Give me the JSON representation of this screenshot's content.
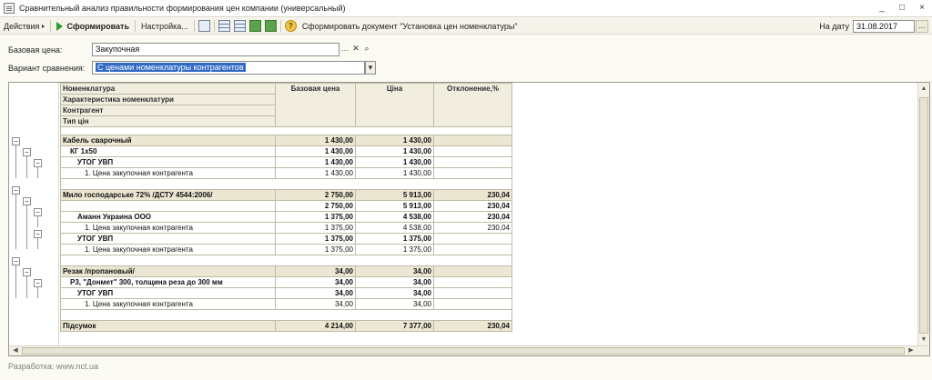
{
  "window": {
    "title": "Сравнительный анализ правильности формирования цен компании (универсальный)",
    "buttons": [
      "_",
      "□",
      "×"
    ]
  },
  "toolbar": {
    "actions": "Действия",
    "generate": "Сформировать",
    "settings": "Настройка...",
    "doc_link": "Сформировать документ \"Установка цен номенклатуры\"",
    "on_date_label": "На дату",
    "on_date_value": "31.08.2017"
  },
  "form": {
    "base_price_label": "Базовая цена:",
    "base_price_value": "Закупочная",
    "compare_label": "Вариант сравнения:",
    "compare_value": "С ценами номенклатуры контрагентов"
  },
  "report": {
    "headers": {
      "col1": [
        "Номенклатура",
        "Характеристика номенклатури",
        "Контрагент",
        "Тип цін"
      ],
      "base": "Базовая цена",
      "price": "Ціна",
      "dev": "Отклонение,%"
    },
    "rows": [
      {
        "type": "grp",
        "name": "Кабель сварочный",
        "base": "1 430,00",
        "price": "1 430,00",
        "dev": ""
      },
      {
        "type": "bold",
        "indent": 1,
        "name": "КГ 1х50",
        "base": "1 430,00",
        "price": "1 430,00",
        "dev": ""
      },
      {
        "type": "bold",
        "indent": 2,
        "name": "УТОГ УВП",
        "base": "1 430,00",
        "price": "1 430,00",
        "dev": ""
      },
      {
        "type": "norm",
        "indent": 3,
        "name": "1. Цена закупочная контрагента",
        "base": "1 430,00",
        "price": "1 430,00",
        "dev": ""
      },
      {
        "type": "spacer"
      },
      {
        "type": "grp",
        "name": "Мило господарське 72% /ДСТУ 4544:2006/",
        "base": "2 750,00",
        "price": "5 913,00",
        "dev": "230,04"
      },
      {
        "type": "bold",
        "indent": 1,
        "name": "",
        "base": "2 750,00",
        "price": "5 913,00",
        "dev": "230,04"
      },
      {
        "type": "bold",
        "indent": 2,
        "name": "Аманн Украина ООО",
        "base": "1 375,00",
        "price": "4 538,00",
        "dev": "230,04"
      },
      {
        "type": "norm",
        "indent": 3,
        "name": "1. Цена закупочная контрагента",
        "base": "1 375,00",
        "price": "4 538,00",
        "dev": "230,04"
      },
      {
        "type": "bold",
        "indent": 2,
        "name": "УТОГ УВП",
        "base": "1 375,00",
        "price": "1 375,00",
        "dev": ""
      },
      {
        "type": "norm",
        "indent": 3,
        "name": "1. Цена закупочная контрагента",
        "base": "1 375,00",
        "price": "1 375,00",
        "dev": ""
      },
      {
        "type": "spacer"
      },
      {
        "type": "grp",
        "name": "Резак /пропановый/",
        "base": "34,00",
        "price": "34,00",
        "dev": ""
      },
      {
        "type": "bold",
        "indent": 1,
        "name": "Р3, \"Донмет\" 300, толщина реза до 300 мм",
        "base": "34,00",
        "price": "34,00",
        "dev": ""
      },
      {
        "type": "bold",
        "indent": 2,
        "name": "УТОГ УВП",
        "base": "34,00",
        "price": "34,00",
        "dev": ""
      },
      {
        "type": "norm",
        "indent": 3,
        "name": "1. Цена закупочная контрагента",
        "base": "34,00",
        "price": "34,00",
        "dev": ""
      },
      {
        "type": "spacer"
      },
      {
        "type": "total",
        "name": "Підсумок",
        "base": "4 214,00",
        "price": "7 377,00",
        "dev": "230,04"
      }
    ]
  },
  "footer": {
    "dev_link": "Разработка: www.nct.ua"
  }
}
